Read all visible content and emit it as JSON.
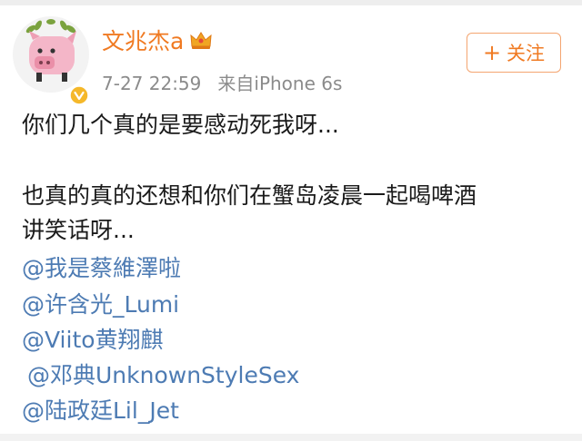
{
  "post": {
    "username": "文兆杰a",
    "time": "7-27 22:59",
    "source": "来自iPhone 6s",
    "follow_label": "关注",
    "follow_icon": "plus-icon",
    "line1": "你们几个真的是要感动死我呀...",
    "line2": "也真的真的还想和你们在蟹岛凌晨一起喝啤酒",
    "line3": "讲笑话呀...",
    "mentions": [
      "@我是蔡維澤啦",
      "@许含光_Lumi",
      "@Viito黄翔麒",
      "@邓典UnknownStyleSex",
      "@陆政廷Lil_Jet"
    ]
  },
  "colors": {
    "username": "#f07a22",
    "mention": "#4d7bb3",
    "meta": "#8b8b8b",
    "body_text": "#1a1a1a"
  }
}
